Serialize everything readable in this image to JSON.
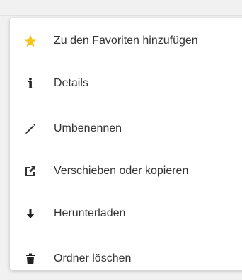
{
  "menu": {
    "items": [
      {
        "id": "favorite",
        "label": "Zu den Favoriten hinzufügen",
        "icon": "star-icon",
        "icon_color": "#f5c518"
      },
      {
        "id": "details",
        "label": "Details",
        "icon": "info-icon",
        "icon_glyph": "i",
        "icon_color": "#222222"
      },
      {
        "id": "rename",
        "label": "Umbenennen",
        "icon": "pencil-icon",
        "icon_color": "#333333"
      },
      {
        "id": "move-copy",
        "label": "Verschieben oder kopieren",
        "icon": "external-link-icon",
        "icon_color": "#333333"
      },
      {
        "id": "download",
        "label": "Herunterladen",
        "icon": "download-arrow-icon",
        "icon_color": "#222222"
      },
      {
        "id": "delete",
        "label": "Ordner löschen",
        "icon": "trash-icon",
        "icon_color": "#222222"
      }
    ]
  }
}
